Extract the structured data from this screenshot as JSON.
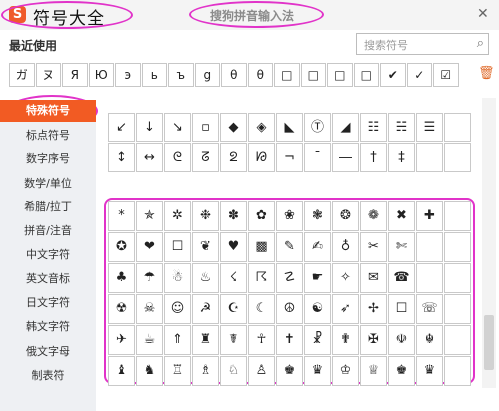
{
  "window": {
    "logo_glyph": "S",
    "title": "符号大全",
    "subtitle": "搜狗拼音输入法",
    "close_glyph": "✕"
  },
  "recent": {
    "label": "最近使用",
    "symbols": [
      "ガ",
      "ヌ",
      "Я",
      "Ю",
      "э",
      "ь",
      "ъ",
      "g",
      "θ",
      "θ",
      "□",
      "□",
      "□",
      "□",
      "✔",
      "✓",
      "☑"
    ],
    "trash_icon": "trash-icon"
  },
  "search": {
    "placeholder": "搜索符号",
    "icon_glyph": "⌕"
  },
  "sidebar": {
    "items": [
      {
        "label": "特殊符号",
        "active": true
      },
      {
        "label": "标点符号"
      },
      {
        "label": "数字序号"
      },
      {
        "label": "数学/单位"
      },
      {
        "label": "希腊/拉丁"
      },
      {
        "label": "拼音/注音"
      },
      {
        "label": "中文字符"
      },
      {
        "label": "英文音标"
      },
      {
        "label": "日文字符"
      },
      {
        "label": "韩文字符"
      },
      {
        "label": "俄文字母"
      },
      {
        "label": "制表符"
      }
    ]
  },
  "arrows": {
    "rows": [
      [
        "↙",
        "↓",
        "↘",
        "▫",
        "◆",
        "◈",
        "◣",
        "Ⓣ",
        "◢",
        "☷",
        "☵",
        "☰",
        ""
      ],
      [
        "↕",
        "↔",
        "ᘓ",
        "ᘔ",
        "ᘖ",
        "ᘙ",
        "¬",
        "ˉ",
        "―",
        "†",
        "‡",
        "",
        ""
      ]
    ]
  },
  "dingbats": {
    "rows": [
      [
        "*",
        "✯",
        "✲",
        "❉",
        "✽",
        "✿",
        "❀",
        "❃",
        "❂",
        "❁",
        "✖",
        "✚",
        ""
      ],
      [
        "✪",
        "❤",
        "☐",
        "❦",
        "♥",
        "▩",
        "✎",
        "✍",
        "♁",
        "✂",
        "✄",
        "",
        ""
      ],
      [
        "♣",
        "☂",
        "☃",
        "♨",
        "☇",
        "☈",
        "☡",
        "☛",
        "✧",
        "✉",
        "☎",
        "",
        ""
      ],
      [
        "☢",
        "☠",
        "☺",
        "☭",
        "☪",
        "☾",
        "☮",
        "☯",
        "➶",
        "✢",
        "☐",
        "☏",
        ""
      ],
      [
        "✈",
        "☕",
        "⇑",
        "♜",
        "☤",
        "☥",
        "✝",
        "☧",
        "✟",
        "✠",
        "☫",
        "☬",
        ""
      ],
      [
        "♝",
        "♞",
        "♖",
        "♗",
        "♘",
        "♙",
        "♚",
        "♛",
        "♔",
        "♕",
        "♚",
        "♛",
        ""
      ]
    ]
  }
}
